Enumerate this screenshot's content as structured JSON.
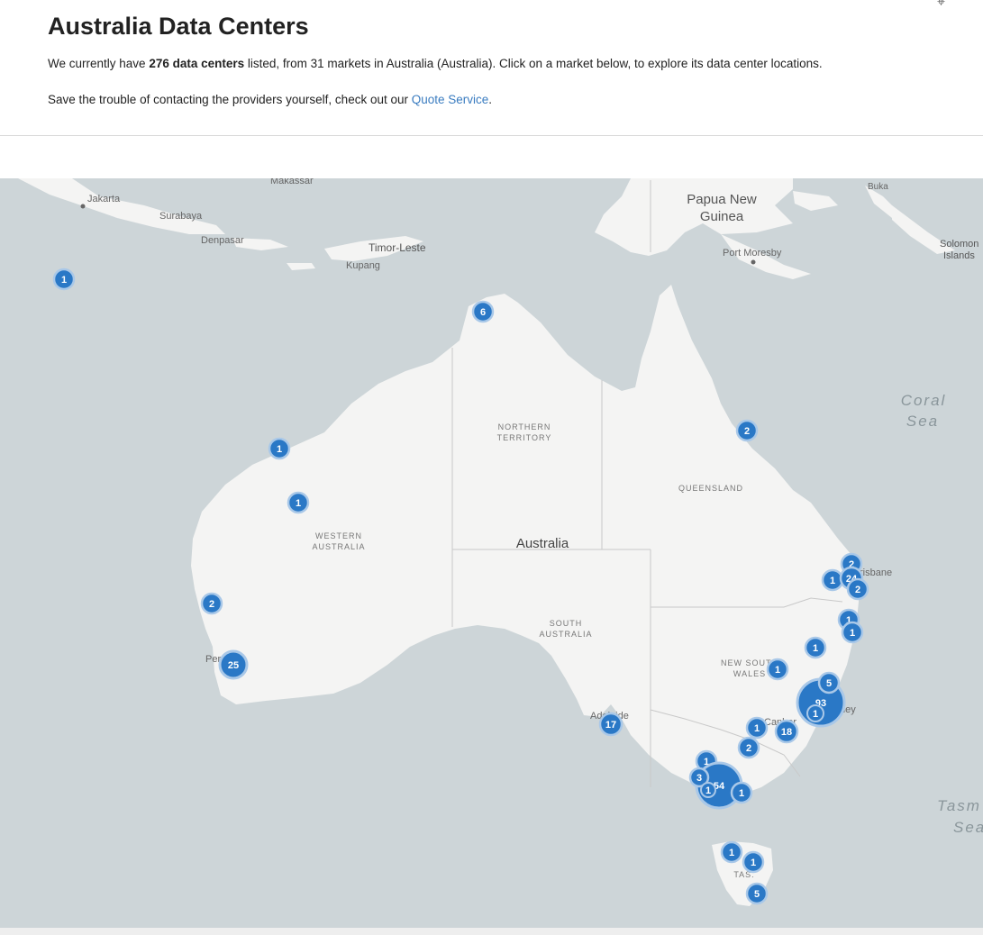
{
  "header": {
    "title": "Australia Data Centers",
    "intro_prefix": "We currently have ",
    "intro_bold": "276 data centers",
    "intro_suffix": " listed, from 31 markets in Australia (Australia). Click on a market below, to explore its data center locations.",
    "quote_prefix": "Save the trouble of contacting the providers yourself, check out our ",
    "quote_link": "Quote Service",
    "quote_suffix": "."
  },
  "map": {
    "colors": {
      "water": "#cdd5d8",
      "land": "#f4f4f3",
      "border": "#c9c9c9",
      "cluster": "#2a78c6",
      "cluster_ring": "#8fb8e2"
    },
    "labels": {
      "papua": "Papua New",
      "guinea": "Guinea",
      "coral": "Coral",
      "sea": "Sea",
      "tasman": "Tasm",
      "tasman_sea": "Sea",
      "australia": "Australia",
      "nt1": "NORTHERN",
      "nt2": "TERRITORY",
      "qld": "QUEENSLAND",
      "wa1": "WESTERN",
      "wa2": "AUSTRALIA",
      "sa1": "SOUTH",
      "sa2": "AUSTRALIA",
      "nsw1": "NEW SOUTH",
      "nsw2": "WALES",
      "tas": "TAS.",
      "jakarta": "Jakarta",
      "surabaya": "Surabaya",
      "denpasar": "Denpasar",
      "makassar": "Makassar",
      "timor": "Timor-Leste",
      "kupang": "Kupang",
      "port_moresby": "Port Moresby",
      "buka": "Buka",
      "solomon1": "Solomon",
      "solomon2": "Islands",
      "brisbane": "risbane",
      "adelaide": "Adelaide",
      "perth": "Per",
      "canberra": "Canber",
      "sydney": "ney"
    },
    "clusters": [
      {
        "count": "1"
      },
      {
        "count": "6"
      },
      {
        "count": "1"
      },
      {
        "count": "1"
      },
      {
        "count": "2"
      },
      {
        "count": "2"
      },
      {
        "count": "25"
      },
      {
        "count": "2"
      },
      {
        "count": "1"
      },
      {
        "count": "24"
      },
      {
        "count": "2"
      },
      {
        "count": "1"
      },
      {
        "count": "1"
      },
      {
        "count": "1"
      },
      {
        "count": "1"
      },
      {
        "count": "5"
      },
      {
        "count": "93"
      },
      {
        "count": "1"
      },
      {
        "count": "1"
      },
      {
        "count": "18"
      },
      {
        "count": "2"
      },
      {
        "count": "17"
      },
      {
        "count": "1"
      },
      {
        "count": "3"
      },
      {
        "count": "1"
      },
      {
        "count": "54"
      },
      {
        "count": "1"
      },
      {
        "count": "1"
      },
      {
        "count": "1"
      },
      {
        "count": "5"
      }
    ]
  }
}
